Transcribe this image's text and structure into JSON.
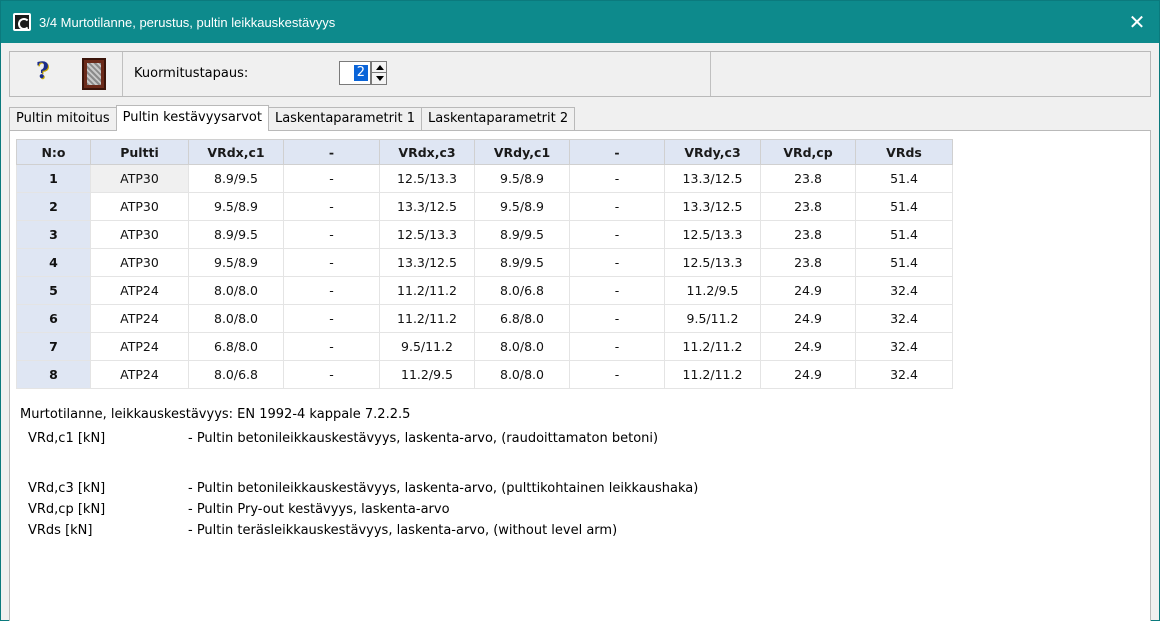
{
  "window": {
    "title": "3/4  Murtotilanne, perustus, pultin leikkauskestävyys",
    "close_glyph": "✕"
  },
  "toolbar": {
    "help_glyph": "?",
    "kuorm_label": "Kuormitustapaus:",
    "kuorm_value": "2"
  },
  "tabs": [
    {
      "label": "Pultin mitoitus",
      "active": false
    },
    {
      "label": "Pultin kestävyysarvot",
      "active": true
    },
    {
      "label": "Laskentaparametrit 1",
      "active": false
    },
    {
      "label": "Laskentaparametrit 2",
      "active": false
    }
  ],
  "table": {
    "headers": [
      "N:o",
      "Pultti",
      "VRdx,c1",
      "-",
      "VRdx,c3",
      "VRdy,c1",
      "-",
      "VRdy,c3",
      "VRd,cp",
      "VRds"
    ],
    "rows": [
      [
        "1",
        "ATP30",
        "8.9/9.5",
        "-",
        "12.5/13.3",
        "9.5/8.9",
        "-",
        "13.3/12.5",
        "23.8",
        "51.4"
      ],
      [
        "2",
        "ATP30",
        "9.5/8.9",
        "-",
        "13.3/12.5",
        "9.5/8.9",
        "-",
        "13.3/12.5",
        "23.8",
        "51.4"
      ],
      [
        "3",
        "ATP30",
        "8.9/9.5",
        "-",
        "12.5/13.3",
        "8.9/9.5",
        "-",
        "12.5/13.3",
        "23.8",
        "51.4"
      ],
      [
        "4",
        "ATP30",
        "9.5/8.9",
        "-",
        "13.3/12.5",
        "8.9/9.5",
        "-",
        "12.5/13.3",
        "23.8",
        "51.4"
      ],
      [
        "5",
        "ATP24",
        "8.0/8.0",
        "-",
        "11.2/11.2",
        "8.0/6.8",
        "-",
        "11.2/9.5",
        "24.9",
        "32.4"
      ],
      [
        "6",
        "ATP24",
        "8.0/8.0",
        "-",
        "11.2/11.2",
        "6.8/8.0",
        "-",
        "9.5/11.2",
        "24.9",
        "32.4"
      ],
      [
        "7",
        "ATP24",
        "6.8/8.0",
        "-",
        "9.5/11.2",
        "8.0/8.0",
        "-",
        "11.2/11.2",
        "24.9",
        "32.4"
      ],
      [
        "8",
        "ATP24",
        "8.0/6.8",
        "-",
        "11.2/9.5",
        "8.0/8.0",
        "-",
        "11.2/11.2",
        "24.9",
        "32.4"
      ]
    ]
  },
  "notes": {
    "heading": "Murtotilanne, leikkauskestävyys: EN 1992-4 kappale 7.2.2.5",
    "definitions": [
      {
        "key": "VRd,c1 [kN]",
        "desc": "- Pultin betonileikkauskestävyys, laskenta-arvo, (raudoittamaton betoni)"
      },
      {
        "key": "VRd,c3 [kN]",
        "desc": "- Pultin betonileikkauskestävyys, laskenta-arvo, (pulttikohtainen leikkaushaka)"
      },
      {
        "key": "VRd,cp [kN]",
        "desc": "- Pultin Pry-out kestävyys, laskenta-arvo"
      },
      {
        "key": "VRds [kN]",
        "desc": "- Pultin teräsleikkauskestävyys, laskenta-arvo, (without level arm)"
      }
    ]
  },
  "colors": {
    "titlebar": "#0d8a8c",
    "header_bg": "#dfe6f3",
    "spin_selection": "#0a64d8"
  },
  "icons": {
    "app": "app-logo-icon",
    "help": "help-icon",
    "door": "door-icon",
    "close": "close-icon"
  }
}
